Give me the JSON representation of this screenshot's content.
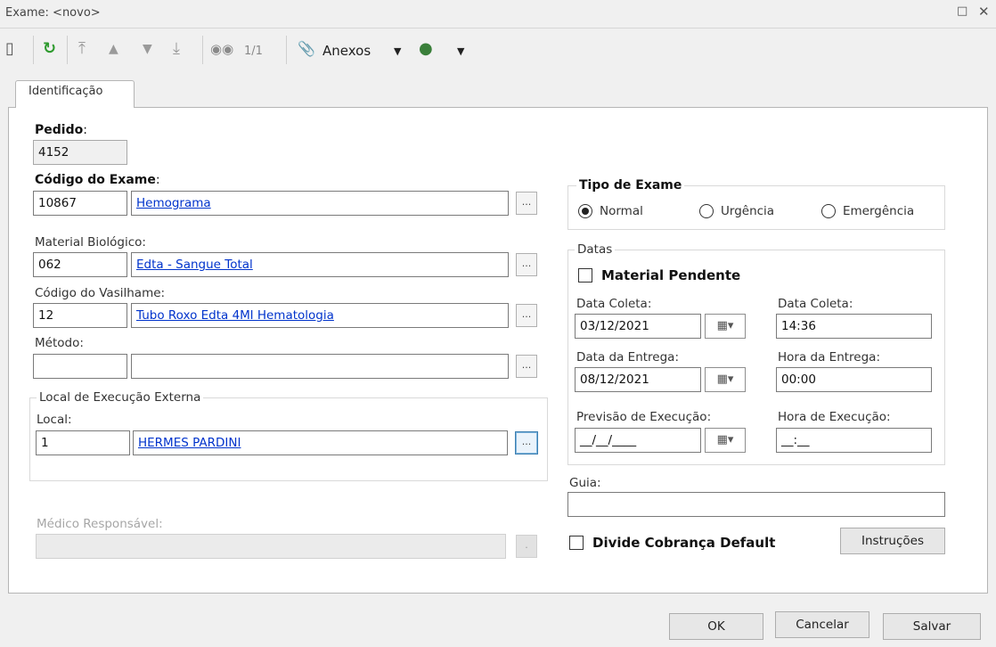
{
  "window": {
    "title": "Exame: <novo>"
  },
  "toolbar": {
    "record_counter": "1/1",
    "attachments_label": "Anexos"
  },
  "tabs": [
    {
      "label": "Identificação",
      "active": true
    }
  ],
  "form": {
    "pedido": {
      "label": "Pedido",
      "colon": ":",
      "value": "4152"
    },
    "codigo_exame": {
      "label": "Código do Exame",
      "colon": ":",
      "code": "10867",
      "name": "Hemograma"
    },
    "material_biologico": {
      "label": "Material Biológico:",
      "code": "062",
      "name": "Edta - Sangue Total"
    },
    "codigo_vasilhame": {
      "label": "Código do Vasilhame:",
      "code": "12",
      "name": "Tubo Roxo Edta 4Ml Hematologia"
    },
    "metodo": {
      "label": "Método:",
      "code": "",
      "name": ""
    },
    "local_execucao_externa": {
      "group_title": "Local de Execução Externa",
      "local_label": "Local:",
      "code": "1",
      "name": "HERMES PARDINI"
    },
    "medico_responsavel": {
      "label": "Médico Responsável:",
      "value": ""
    },
    "ellipsis": "...",
    "ellipsis_disabled": "."
  },
  "tipo_exame": {
    "group_title": "Tipo de Exame",
    "options": [
      {
        "label": "Normal",
        "selected": true
      },
      {
        "label": "Urgência",
        "selected": false
      },
      {
        "label": "Emergência",
        "selected": false
      }
    ]
  },
  "datas": {
    "group_title": "Datas",
    "material_pendente": {
      "label": "Material Pendente",
      "checked": false
    },
    "data_coleta": {
      "label": "Data Coleta:",
      "value": "03/12/2021"
    },
    "hora_coleta": {
      "label": "Data Coleta:",
      "value": "14:36"
    },
    "data_entrega": {
      "label": "Data da Entrega:",
      "value": "08/12/2021"
    },
    "hora_entrega": {
      "label": "Hora da Entrega:",
      "value": "00:00"
    },
    "previsao_execucao": {
      "label": "Previsão de Execução:",
      "value": "__/__/____"
    },
    "hora_execucao": {
      "label": "Hora de Execução:",
      "value": "__:__"
    }
  },
  "guia": {
    "label": "Guia:",
    "value": ""
  },
  "divide_cobranca": {
    "label": "Divide Cobrança Default",
    "checked": false
  },
  "buttons": {
    "instrucoes": "Instruções",
    "ok": "OK",
    "cancelar": "Cancelar",
    "salvar": "Salvar"
  },
  "colors": {
    "link": "#0033cc",
    "refresh_icon": "#2e9a2e",
    "focus_border": "#3c7fb1"
  }
}
